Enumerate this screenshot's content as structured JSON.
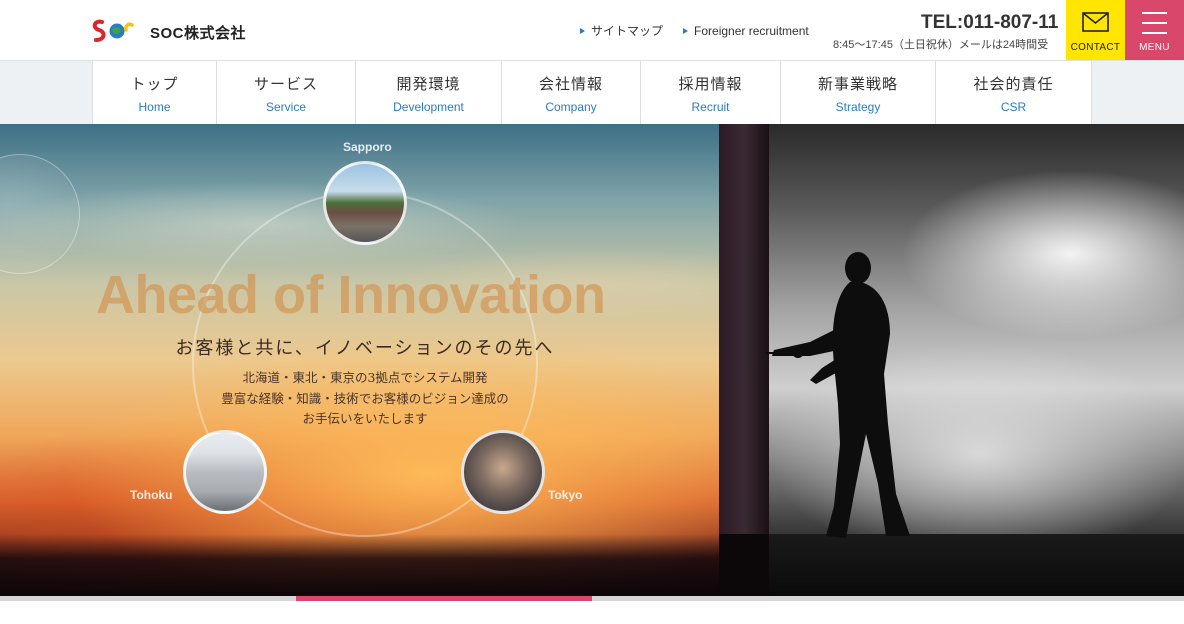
{
  "header": {
    "logo_text": "SOC株式会社",
    "util_links": [
      "サイトマップ",
      "Foreigner recruitment"
    ],
    "tel": "TEL:011-807-11",
    "hours": "8:45〜17:45（土日祝休）メールは24時間受",
    "contact_label": "CONTACT",
    "menu_label": "MENU",
    "colors": {
      "contact_bg": "#ffe500",
      "menu_bg": "#d9486a",
      "link_accent": "#2a7cc0"
    }
  },
  "nav": {
    "items": [
      {
        "jp": "トップ",
        "en": "Home"
      },
      {
        "jp": "サービス",
        "en": "Service"
      },
      {
        "jp": "開発環境",
        "en": "Development"
      },
      {
        "jp": "会社情報",
        "en": "Company"
      },
      {
        "jp": "採用情報",
        "en": "Recruit"
      },
      {
        "jp": "新事業戦略",
        "en": "Strategy"
      },
      {
        "jp": "社会的責任",
        "en": "CSR"
      }
    ]
  },
  "hero": {
    "title": "Ahead of Innovation",
    "subtitle": "お客様と共に、イノベーションのその先へ",
    "desc": [
      "北海道・東北・東京の3拠点でシステム開発",
      "豊富な経験・知識・技術でお客様のビジョン達成の",
      "お手伝いをいたします"
    ],
    "offices": [
      "Sapporo",
      "Tohoku",
      "Tokyo"
    ]
  },
  "slider": {
    "active_index": 1,
    "count": 4
  }
}
